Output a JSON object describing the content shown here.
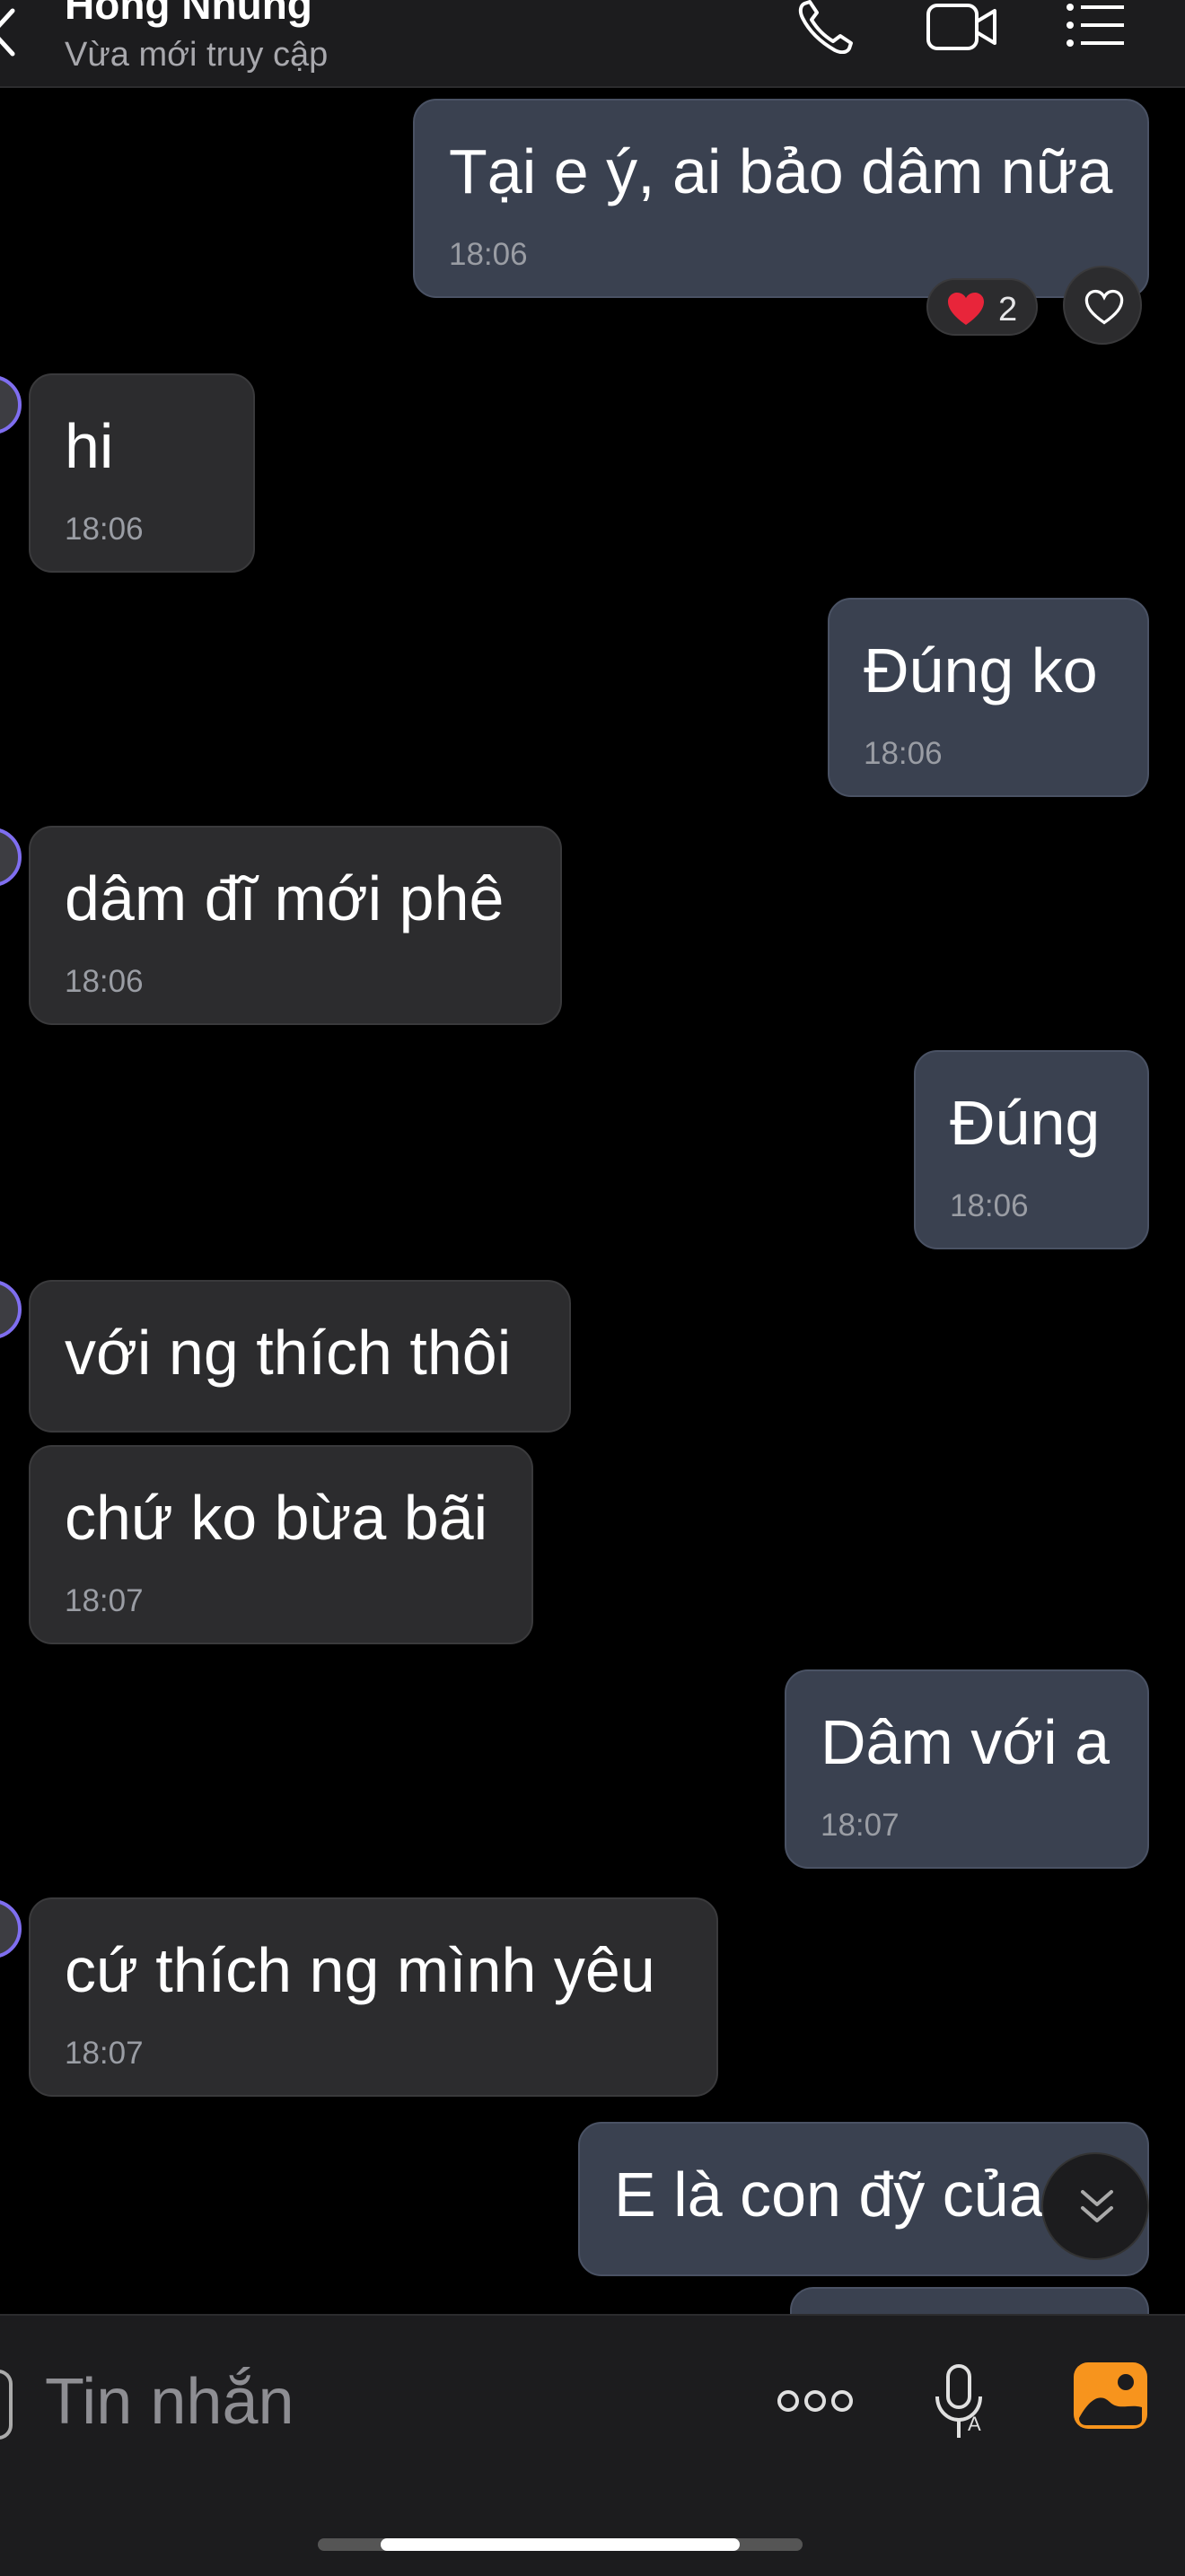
{
  "header": {
    "title": "Hồng Nhung",
    "subtitle": "Vừa mới truy cập"
  },
  "messages": [
    {
      "direction": "out",
      "text": "Tại e ý, ai bảo dâm nữa",
      "time": "18:06"
    },
    {
      "direction": "in",
      "text": "hi",
      "time": "18:06"
    },
    {
      "direction": "out",
      "text": "Đúng ko",
      "time": "18:06"
    },
    {
      "direction": "in",
      "text": "dâm đĩ mới phê",
      "time": "18:06"
    },
    {
      "direction": "out",
      "text": "Đúng",
      "time": "18:06"
    },
    {
      "direction": "in",
      "text": "với ng thích thôi",
      "time": ""
    },
    {
      "direction": "in",
      "text": "chứ ko bừa bãi",
      "time": "18:07"
    },
    {
      "direction": "out",
      "text": "Dâm với a",
      "time": "18:07"
    },
    {
      "direction": "in",
      "text": "cứ thích ng mình yêu",
      "time": "18:07"
    },
    {
      "direction": "out",
      "text": "E là con đỹ của",
      "time": ""
    }
  ],
  "reaction": {
    "emoji": "heart",
    "count": "2"
  },
  "input": {
    "placeholder": "Tin nhắn"
  },
  "colors": {
    "background": "#000000",
    "outgoing_bubble": "#3a4150",
    "incoming_bubble": "#2c2c2e",
    "image_button": "#f7941d",
    "reaction_heart": "#e8253a"
  },
  "icons": [
    "back-icon",
    "phone-icon",
    "video-call-icon",
    "menu-list-icon",
    "heart-outline-icon",
    "chevron-double-down-icon",
    "more-dots-icon",
    "mic-icon",
    "image-icon"
  ]
}
